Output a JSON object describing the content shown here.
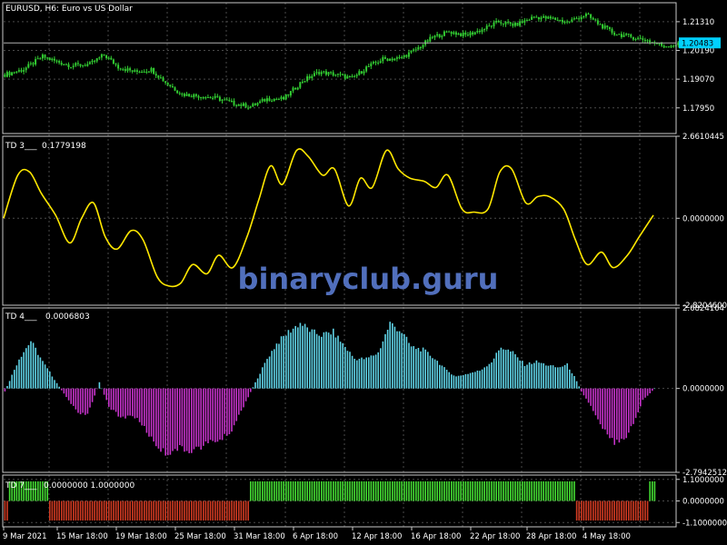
{
  "colors": {
    "background": "#000000",
    "grid": "#4a4a4a",
    "frame": "#c8c8c8",
    "text": "#ffffff",
    "candle": "#32cd32",
    "td3_line": "#ffe800",
    "td4_positive": "#5fd3e6",
    "td4_negative": "#c433c9",
    "td7_positive": "#44dd33",
    "td7_negative": "#d03a22",
    "price_tag_bg": "#00d0ff",
    "watermark": "#5a7bd0"
  },
  "chart_data": [
    {
      "type": "candlestick",
      "title": "EURUSD, H6:  Euro vs US Dollar",
      "ylim": [
        1.1695,
        1.2205
      ],
      "yticks": [
        "1.21310",
        "1.20190",
        "1.19070",
        "1.17950"
      ],
      "ytick_values": [
        1.2131,
        1.2019,
        1.1907,
        1.1795
      ],
      "current_price": "1.20483",
      "current_value": 1.20483,
      "close_path": [
        [
          0,
          1.1925
        ],
        [
          8,
          1.1945
        ],
        [
          16,
          1.1995
        ],
        [
          22,
          1.1975
        ],
        [
          28,
          1.196
        ],
        [
          36,
          1.1965
        ],
        [
          42,
          1.2002
        ],
        [
          48,
          1.1955
        ],
        [
          55,
          1.1935
        ],
        [
          62,
          1.1945
        ],
        [
          68,
          1.1895
        ],
        [
          75,
          1.1848
        ],
        [
          82,
          1.1842
        ],
        [
          90,
          1.1832
        ],
        [
          97,
          1.1812
        ],
        [
          104,
          1.18
        ],
        [
          111,
          1.183
        ],
        [
          118,
          1.183
        ],
        [
          126,
          1.19
        ],
        [
          133,
          1.1935
        ],
        [
          140,
          1.1925
        ],
        [
          147,
          1.191
        ],
        [
          153,
          1.1952
        ],
        [
          160,
          1.1985
        ],
        [
          167,
          1.1988
        ],
        [
          174,
          1.2022
        ],
        [
          181,
          1.207
        ],
        [
          188,
          1.2092
        ],
        [
          195,
          1.2078
        ],
        [
          202,
          1.21
        ],
        [
          209,
          1.213
        ],
        [
          216,
          1.2118
        ],
        [
          224,
          1.215
        ],
        [
          232,
          1.2142
        ],
        [
          238,
          1.213
        ],
        [
          246,
          1.2158
        ],
        [
          252,
          1.2118
        ],
        [
          258,
          1.2085
        ],
        [
          266,
          1.207
        ],
        [
          272,
          1.2058
        ],
        [
          279,
          1.2035
        ],
        [
          286,
          1.2045
        ]
      ]
    },
    {
      "type": "line",
      "indicator": "TD 3___",
      "value_label": "0.1779198",
      "ylim": [
        -2.82046,
        2.6610445
      ],
      "yticks": [
        "2.6610445",
        "0.0000000",
        "-2.8204600"
      ],
      "ytick_values": [
        2.6610445,
        0.0,
        -2.82046
      ],
      "points": [
        [
          0,
          0.0
        ],
        [
          6,
          1.4
        ],
        [
          11,
          1.5
        ],
        [
          16,
          0.8
        ],
        [
          22,
          0.1
        ],
        [
          28,
          -0.8
        ],
        [
          33,
          0.0
        ],
        [
          38,
          0.5
        ],
        [
          43,
          -0.6
        ],
        [
          48,
          -1.0
        ],
        [
          54,
          -0.4
        ],
        [
          59,
          -0.7
        ],
        [
          65,
          -1.9
        ],
        [
          70,
          -2.2
        ],
        [
          75,
          -2.1
        ],
        [
          80,
          -1.5
        ],
        [
          86,
          -1.8
        ],
        [
          91,
          -1.2
        ],
        [
          97,
          -1.6
        ],
        [
          103,
          -0.6
        ],
        [
          108,
          0.6
        ],
        [
          113,
          1.7
        ],
        [
          118,
          1.1
        ],
        [
          124,
          2.2
        ],
        [
          129,
          2.0
        ],
        [
          135,
          1.4
        ],
        [
          140,
          1.6
        ],
        [
          146,
          0.4
        ],
        [
          151,
          1.3
        ],
        [
          156,
          1.0
        ],
        [
          162,
          2.2
        ],
        [
          167,
          1.6
        ],
        [
          172,
          1.3
        ],
        [
          178,
          1.2
        ],
        [
          183,
          1.0
        ],
        [
          188,
          1.4
        ],
        [
          194,
          0.3
        ],
        [
          199,
          0.2
        ],
        [
          205,
          0.3
        ],
        [
          210,
          1.5
        ],
        [
          215,
          1.6
        ],
        [
          221,
          0.5
        ],
        [
          226,
          0.7
        ],
        [
          231,
          0.7
        ],
        [
          237,
          0.3
        ],
        [
          242,
          -0.7
        ],
        [
          247,
          -1.5
        ],
        [
          253,
          -1.1
        ],
        [
          258,
          -1.6
        ],
        [
          264,
          -1.2
        ],
        [
          269,
          -0.6
        ],
        [
          275,
          0.1
        ]
      ]
    },
    {
      "type": "bar",
      "indicator": "TD 4___",
      "value_label": "0.0006803",
      "ylim": [
        -2.79425,
        2.6824164
      ],
      "yticks": [
        "2.6824164",
        "0.0000000",
        "-2.7942512"
      ],
      "ytick_values": [
        2.6824164,
        0.0,
        -2.7942512
      ],
      "profile": [
        [
          0,
          -0.1
        ],
        [
          6,
          1.0
        ],
        [
          11,
          1.6
        ],
        [
          16,
          0.9
        ],
        [
          21,
          0.3
        ],
        [
          26,
          -0.3
        ],
        [
          31,
          -0.8
        ],
        [
          35,
          -0.9
        ],
        [
          40,
          0.2
        ],
        [
          44,
          -0.6
        ],
        [
          49,
          -1.0
        ],
        [
          54,
          -0.9
        ],
        [
          58,
          -1.2
        ],
        [
          63,
          -1.8
        ],
        [
          68,
          -2.2
        ],
        [
          73,
          -2.0
        ],
        [
          77,
          -2.1
        ],
        [
          82,
          -2.0
        ],
        [
          87,
          -1.8
        ],
        [
          92,
          -1.7
        ],
        [
          96,
          -1.4
        ],
        [
          101,
          -0.6
        ],
        [
          106,
          0.2
        ],
        [
          111,
          1.0
        ],
        [
          115,
          1.5
        ],
        [
          120,
          1.9
        ],
        [
          125,
          2.2
        ],
        [
          130,
          1.9
        ],
        [
          134,
          1.8
        ],
        [
          139,
          1.9
        ],
        [
          144,
          1.4
        ],
        [
          148,
          1.0
        ],
        [
          153,
          1.0
        ],
        [
          158,
          1.2
        ],
        [
          163,
          2.2
        ],
        [
          168,
          1.9
        ],
        [
          172,
          1.4
        ],
        [
          177,
          1.3
        ],
        [
          182,
          1.0
        ],
        [
          187,
          0.6
        ],
        [
          191,
          0.4
        ],
        [
          196,
          0.5
        ],
        [
          201,
          0.6
        ],
        [
          206,
          0.9
        ],
        [
          210,
          1.4
        ],
        [
          215,
          1.2
        ],
        [
          220,
          0.8
        ],
        [
          225,
          0.9
        ],
        [
          229,
          0.8
        ],
        [
          234,
          0.7
        ],
        [
          238,
          0.8
        ],
        [
          241,
          0.4
        ],
        [
          244,
          -0.1
        ],
        [
          248,
          -0.6
        ],
        [
          253,
          -1.3
        ],
        [
          258,
          -1.8
        ],
        [
          263,
          -1.6
        ],
        [
          267,
          -1.0
        ],
        [
          270,
          -0.4
        ],
        [
          275,
          0.0
        ]
      ]
    },
    {
      "type": "bar",
      "indicator": "TD 7___",
      "value_label": "0.0000000 1.0000000",
      "ylim": [
        -1.32,
        1.32
      ],
      "yticks": [
        "1.1000000",
        "0.0000000",
        "-1.1000000"
      ],
      "ytick_values": [
        1.1,
        0.0,
        -1.1
      ],
      "segments": [
        {
          "from": 0,
          "to": 1,
          "value": -1
        },
        {
          "from": 2,
          "to": 18,
          "value": 1
        },
        {
          "from": 19,
          "to": 103,
          "value": -1
        },
        {
          "from": 104,
          "to": 241,
          "value": 1
        },
        {
          "from": 242,
          "to": 272,
          "value": -1
        },
        {
          "from": 273,
          "to": 275,
          "value": 1
        }
      ]
    }
  ],
  "x_axis": {
    "labels": [
      "9 Mar 2021",
      "15 Mar 18:00",
      "19 Mar 18:00",
      "25 Mar 18:00",
      "31 Mar 18:00",
      "6 Apr 18:00",
      "12 Apr 18:00",
      "16 Apr 18:00",
      "22 Apr 18:00",
      "28 Apr 18:00",
      "4 May 18:00"
    ]
  },
  "watermark": "binaryclub.guru"
}
